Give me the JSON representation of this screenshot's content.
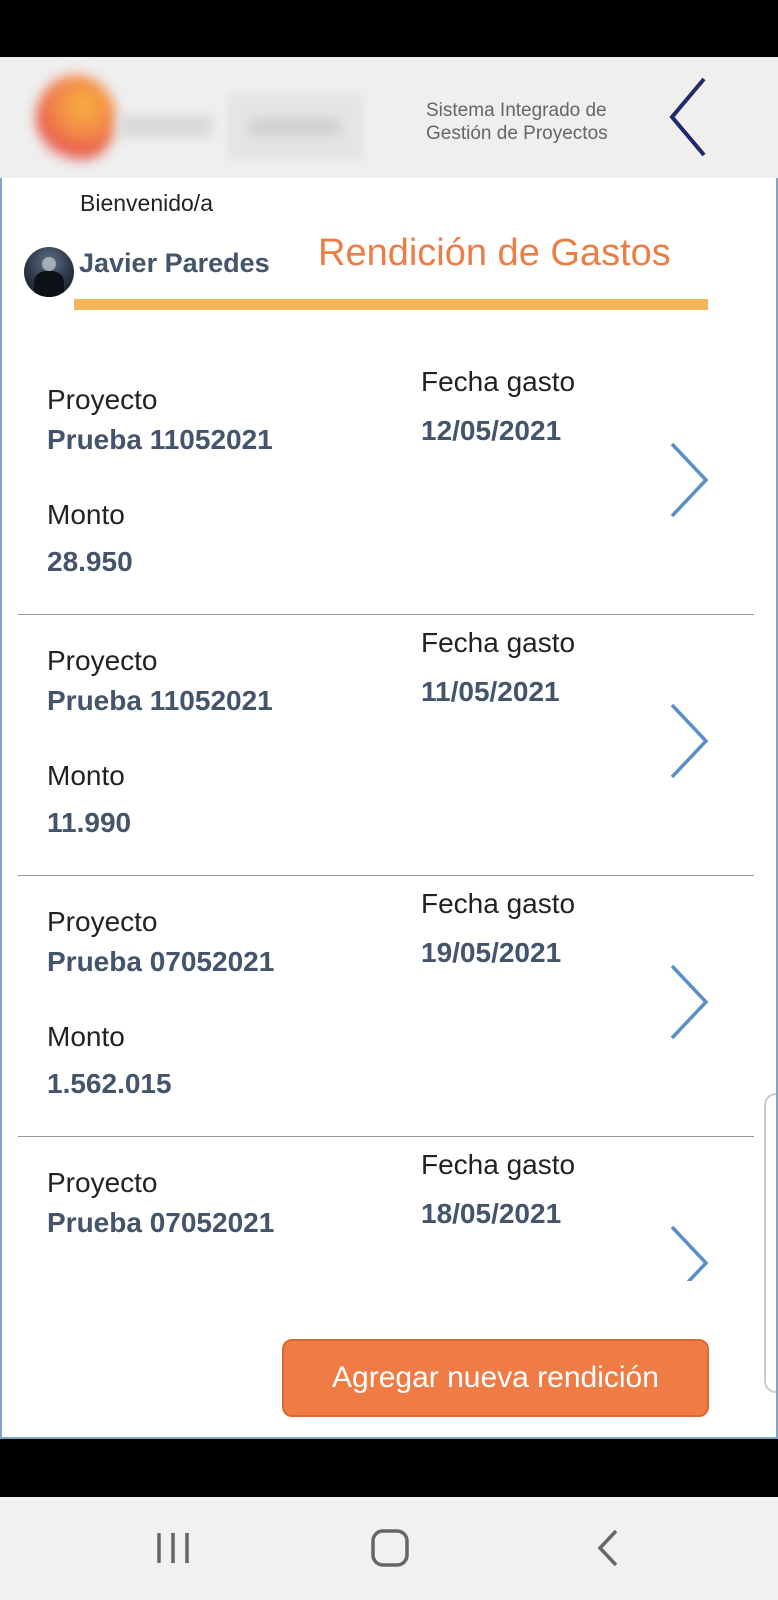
{
  "header": {
    "system_title_line1": "Sistema Integrado de",
    "system_title_line2": "Gestión de Proyectos",
    "back_icon": "chevron-left-icon"
  },
  "user": {
    "welcome": "Bienvenido/a",
    "name": "Javier Paredes"
  },
  "page": {
    "title": "Rendición de Gastos",
    "accent_color": "#ec7e45",
    "underline_color": "#f2b557"
  },
  "labels": {
    "project": "Proyecto",
    "amount": "Monto",
    "date": "Fecha gasto"
  },
  "expenses": [
    {
      "project": "Prueba 11052021",
      "amount": "28.950",
      "date": "12/05/2021"
    },
    {
      "project": "Prueba 11052021",
      "amount": "11.990",
      "date": "11/05/2021"
    },
    {
      "project": "Prueba 07052021",
      "amount": "1.562.015",
      "date": "19/05/2021"
    },
    {
      "project": "Prueba 07052021",
      "amount": "",
      "date": "18/05/2021"
    }
  ],
  "actions": {
    "add_button": "Agregar nueva rendición"
  },
  "system_nav": {
    "recent_icon": "recent-apps-icon",
    "home_icon": "home-icon",
    "back_icon": "back-icon"
  }
}
